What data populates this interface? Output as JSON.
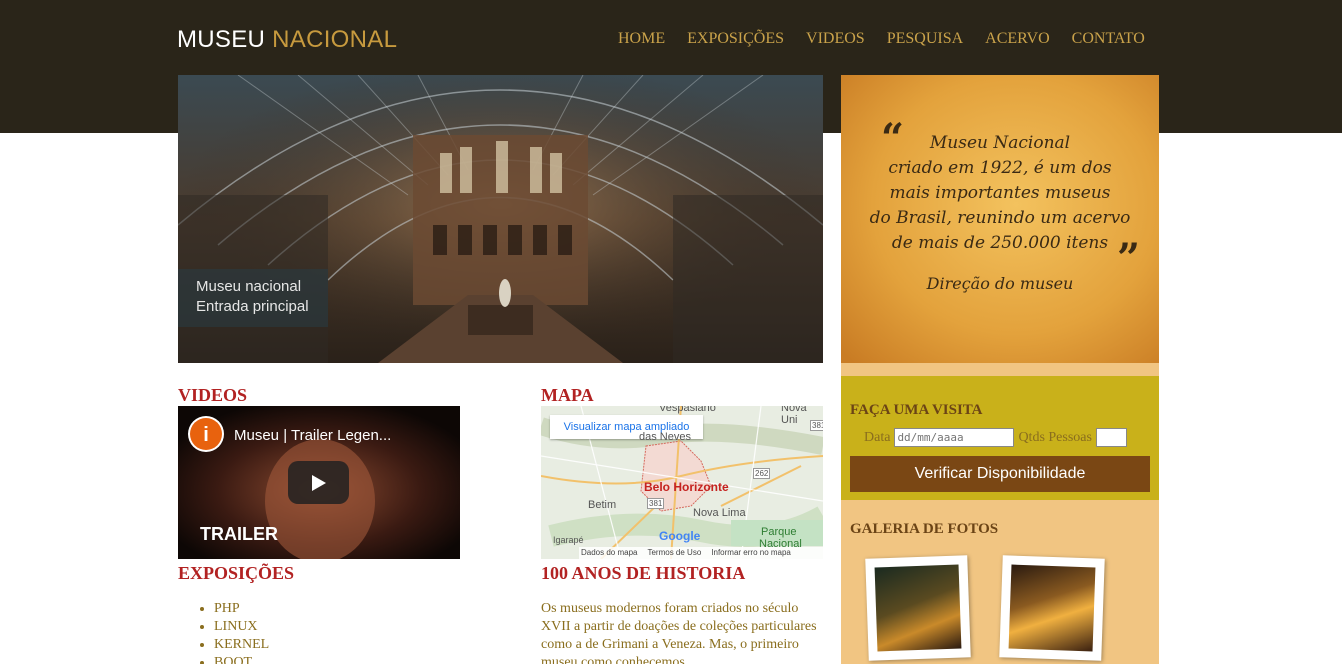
{
  "header": {
    "logo_part1": "MUSEU",
    "logo_part2": "NACIONAL",
    "nav": [
      "HOME",
      "EXPOSIÇÕES",
      "VIDEOS",
      "PESQUISA",
      "ACERVO",
      "CONTATO"
    ]
  },
  "hero": {
    "caption_line1": "Museu nacional",
    "caption_line2": "Entrada principal"
  },
  "quote": {
    "lines": [
      "Museu Nacional",
      "criado em 1922, é um dos",
      "mais importantes museus",
      "do Brasil, reunindo um acervo",
      "de mais de 250.000 itens"
    ],
    "author": "Direção do museu"
  },
  "visit": {
    "title": "FAÇA UMA VISITA",
    "date_label": "Data",
    "date_placeholder": "dd/mm/aaaa",
    "people_label": "Qtds Pessoas",
    "button": "Verificar Disponibilidade"
  },
  "gallery": {
    "title": "GALERIA DE FOTOS"
  },
  "videos": {
    "title": "VIDEOS",
    "video_title": "Museu | Trailer Legen...",
    "overlay_text": "TRAILER"
  },
  "map": {
    "title": "MAPA",
    "button": "Visualizar mapa ampliado",
    "city": "Belo Horizonte",
    "labels": [
      "Vespasiano",
      "Nova Uni",
      "das Neves",
      "Betim",
      "Nova Lima",
      "Igarapé",
      "Parque",
      "Nacional"
    ],
    "road_labels": [
      "381",
      "262",
      "381"
    ],
    "footer": [
      "Dados do mapa",
      "Termos de Uso",
      "Informar erro no mapa"
    ],
    "brand": "Google"
  },
  "exposicoes": {
    "title": "EXPOSIÇÕES",
    "items": [
      "PHP",
      "LINUX",
      "KERNEL",
      "BOOT"
    ]
  },
  "history": {
    "title": "100 ANOS DE HISTORIA",
    "text": "Os museus modernos foram criados no século XVII a partir de doações de coleções particulares como a de Grimani a Veneza. Mas, o primeiro museu como conhecemos"
  },
  "colors": {
    "header_bg": "#2a2519",
    "nav": "#c9a24a",
    "accent_red": "#b22222",
    "visit_bg": "#c9b11a",
    "button_bg": "#7a4714",
    "gallery_bg": "#f1c582"
  }
}
